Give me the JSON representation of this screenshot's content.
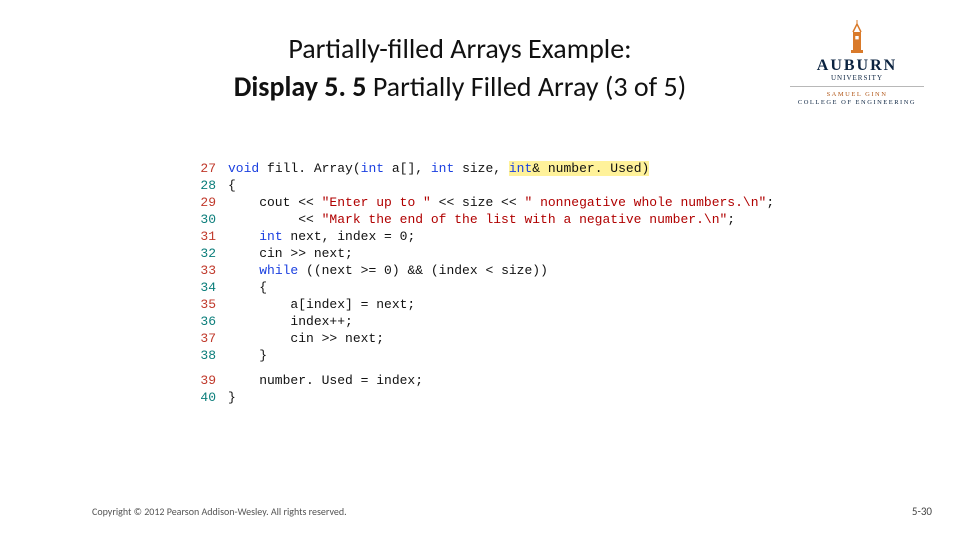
{
  "title": {
    "line1": "Partially-filled Arrays Example:",
    "line2_bold": "Display 5. 5",
    "line2_rest": "  Partially Filled Array (3 of 5)"
  },
  "logo": {
    "main": "AUBURN",
    "sub": "UNIVERSITY",
    "college_line1": "SAMUEL GINN",
    "college_line2": "COLLEGE OF ENGINEERING"
  },
  "code": {
    "lines": [
      {
        "n": 27,
        "segs": [
          {
            "t": "void",
            "c": "kw"
          },
          {
            "t": " fill. Array("
          },
          {
            "t": "int",
            "c": "kw"
          },
          {
            "t": " a[], "
          },
          {
            "t": "int",
            "c": "kw"
          },
          {
            "t": " size, "
          },
          {
            "t": "int",
            "c": "kw hl"
          },
          {
            "t": "& number. Used)",
            "c": "hl"
          }
        ]
      },
      {
        "n": 28,
        "segs": [
          {
            "t": "{"
          }
        ]
      },
      {
        "n": 29,
        "segs": [
          {
            "t": "    cout << "
          },
          {
            "t": "\"Enter up to \"",
            "c": "str"
          },
          {
            "t": " << size << "
          },
          {
            "t": "\" nonnegative whole numbers.\\n\"",
            "c": "str"
          },
          {
            "t": ";"
          }
        ]
      },
      {
        "n": 30,
        "segs": [
          {
            "t": "         << "
          },
          {
            "t": "\"Mark the end of the list with a negative number.\\n\"",
            "c": "str"
          },
          {
            "t": ";"
          }
        ]
      },
      {
        "n": 31,
        "segs": [
          {
            "t": "    "
          },
          {
            "t": "int",
            "c": "kw"
          },
          {
            "t": " next, index = 0;"
          }
        ]
      },
      {
        "n": 32,
        "segs": [
          {
            "t": "    cin >> next;"
          }
        ]
      },
      {
        "n": 33,
        "segs": [
          {
            "t": "    "
          },
          {
            "t": "while",
            "c": "kw"
          },
          {
            "t": " ((next >= 0) && (index < size))"
          }
        ]
      },
      {
        "n": 34,
        "segs": [
          {
            "t": "    {"
          }
        ]
      },
      {
        "n": 35,
        "segs": [
          {
            "t": "        a[index] = next;"
          }
        ]
      },
      {
        "n": 36,
        "segs": [
          {
            "t": "        index++;"
          }
        ]
      },
      {
        "n": 37,
        "segs": [
          {
            "t": "        cin >> next;"
          }
        ]
      },
      {
        "n": 38,
        "segs": [
          {
            "t": "    }"
          }
        ]
      },
      {
        "gap": true
      },
      {
        "n": 39,
        "segs": [
          {
            "t": "    number. Used = index;"
          }
        ]
      },
      {
        "n": 40,
        "segs": [
          {
            "t": "}"
          }
        ]
      }
    ]
  },
  "footer": {
    "copyright": "Copyright © 2012 Pearson Addison-Wesley. All rights reserved.",
    "page": "5-30"
  }
}
